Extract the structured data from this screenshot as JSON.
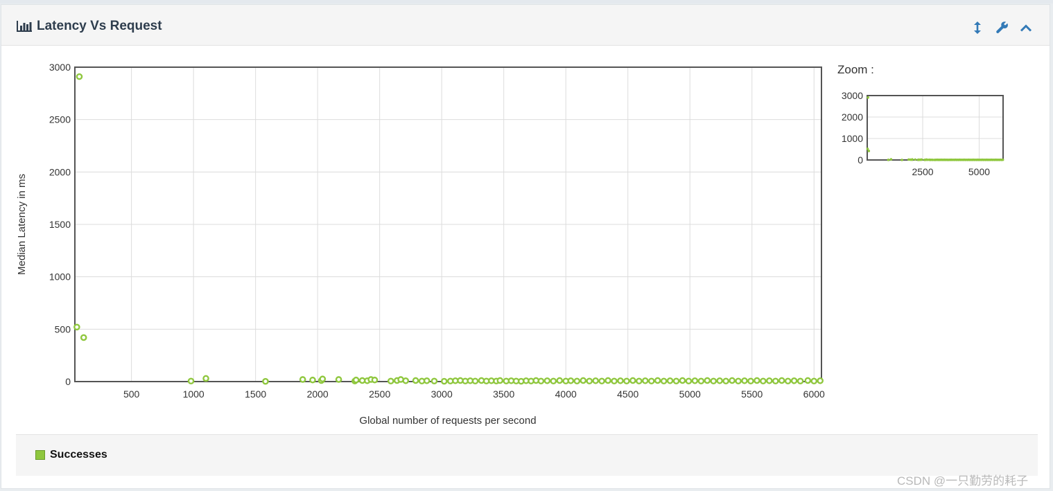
{
  "panel": {
    "title": "Latency Vs Request",
    "zoom_label": "Zoom :",
    "legend_label": "Successes",
    "watermark": "CSDN @一只勤劳的耗子"
  },
  "icons": {
    "title_icon": "bar-chart-icon",
    "resize_icon": "vertical-resize-icon",
    "settings_icon": "wrench-icon",
    "collapse_icon": "chevron-up-icon"
  },
  "colors": {
    "series": "#8fc73e",
    "accent": "#337ab7",
    "title": "#2e3d4d"
  },
  "chart_data": {
    "type": "scatter",
    "title": "",
    "xlabel": "Global number of requests per second",
    "ylabel": "Median Latency in ms",
    "xlim": [
      44,
      6060
    ],
    "ylim": [
      0,
      3000
    ],
    "xticks": [
      500,
      1000,
      1500,
      2000,
      2500,
      3000,
      3500,
      4000,
      4500,
      5000,
      5500,
      6000
    ],
    "yticks": [
      0,
      500,
      1000,
      1500,
      2000,
      2500,
      3000
    ],
    "grid": true,
    "legend": "bottom",
    "series": [
      {
        "name": "Successes",
        "color": "#8fc73e",
        "points": [
          [
            80,
            2910
          ],
          [
            60,
            520
          ],
          [
            115,
            420
          ],
          [
            980,
            5
          ],
          [
            1100,
            30
          ],
          [
            1580,
            2
          ],
          [
            1880,
            20
          ],
          [
            1960,
            15
          ],
          [
            2030,
            10
          ],
          [
            2040,
            25
          ],
          [
            2170,
            20
          ],
          [
            2300,
            5
          ],
          [
            2310,
            15
          ],
          [
            2360,
            10
          ],
          [
            2400,
            8
          ],
          [
            2430,
            20
          ],
          [
            2460,
            15
          ],
          [
            2590,
            5
          ],
          [
            2640,
            10
          ],
          [
            2670,
            20
          ],
          [
            2710,
            8
          ],
          [
            2790,
            10
          ],
          [
            2840,
            5
          ],
          [
            2880,
            8
          ],
          [
            2940,
            5
          ],
          [
            3020,
            3
          ],
          [
            3070,
            5
          ],
          [
            3110,
            8
          ],
          [
            3150,
            10
          ],
          [
            3190,
            5
          ],
          [
            3230,
            8
          ],
          [
            3270,
            5
          ],
          [
            3320,
            10
          ],
          [
            3360,
            5
          ],
          [
            3400,
            8
          ],
          [
            3440,
            5
          ],
          [
            3470,
            10
          ],
          [
            3520,
            5
          ],
          [
            3560,
            8
          ],
          [
            3600,
            5
          ],
          [
            3640,
            3
          ],
          [
            3680,
            8
          ],
          [
            3720,
            5
          ],
          [
            3760,
            10
          ],
          [
            3800,
            5
          ],
          [
            3850,
            8
          ],
          [
            3900,
            5
          ],
          [
            3950,
            10
          ],
          [
            4000,
            5
          ],
          [
            4040,
            8
          ],
          [
            4090,
            5
          ],
          [
            4140,
            10
          ],
          [
            4190,
            5
          ],
          [
            4240,
            8
          ],
          [
            4290,
            5
          ],
          [
            4340,
            10
          ],
          [
            4390,
            5
          ],
          [
            4440,
            8
          ],
          [
            4490,
            5
          ],
          [
            4540,
            10
          ],
          [
            4590,
            5
          ],
          [
            4640,
            8
          ],
          [
            4690,
            5
          ],
          [
            4740,
            10
          ],
          [
            4790,
            5
          ],
          [
            4840,
            8
          ],
          [
            4890,
            5
          ],
          [
            4940,
            10
          ],
          [
            4990,
            5
          ],
          [
            5040,
            8
          ],
          [
            5090,
            5
          ],
          [
            5140,
            10
          ],
          [
            5190,
            5
          ],
          [
            5240,
            8
          ],
          [
            5290,
            5
          ],
          [
            5340,
            10
          ],
          [
            5390,
            5
          ],
          [
            5440,
            8
          ],
          [
            5490,
            5
          ],
          [
            5540,
            10
          ],
          [
            5590,
            5
          ],
          [
            5640,
            8
          ],
          [
            5690,
            5
          ],
          [
            5740,
            10
          ],
          [
            5790,
            5
          ],
          [
            5840,
            8
          ],
          [
            5890,
            5
          ],
          [
            5950,
            10
          ],
          [
            6000,
            5
          ],
          [
            6050,
            8
          ]
        ]
      }
    ]
  },
  "zoom_chart": {
    "xticks": [
      2500,
      5000
    ],
    "yticks": [
      0,
      1000,
      2000,
      3000
    ]
  }
}
